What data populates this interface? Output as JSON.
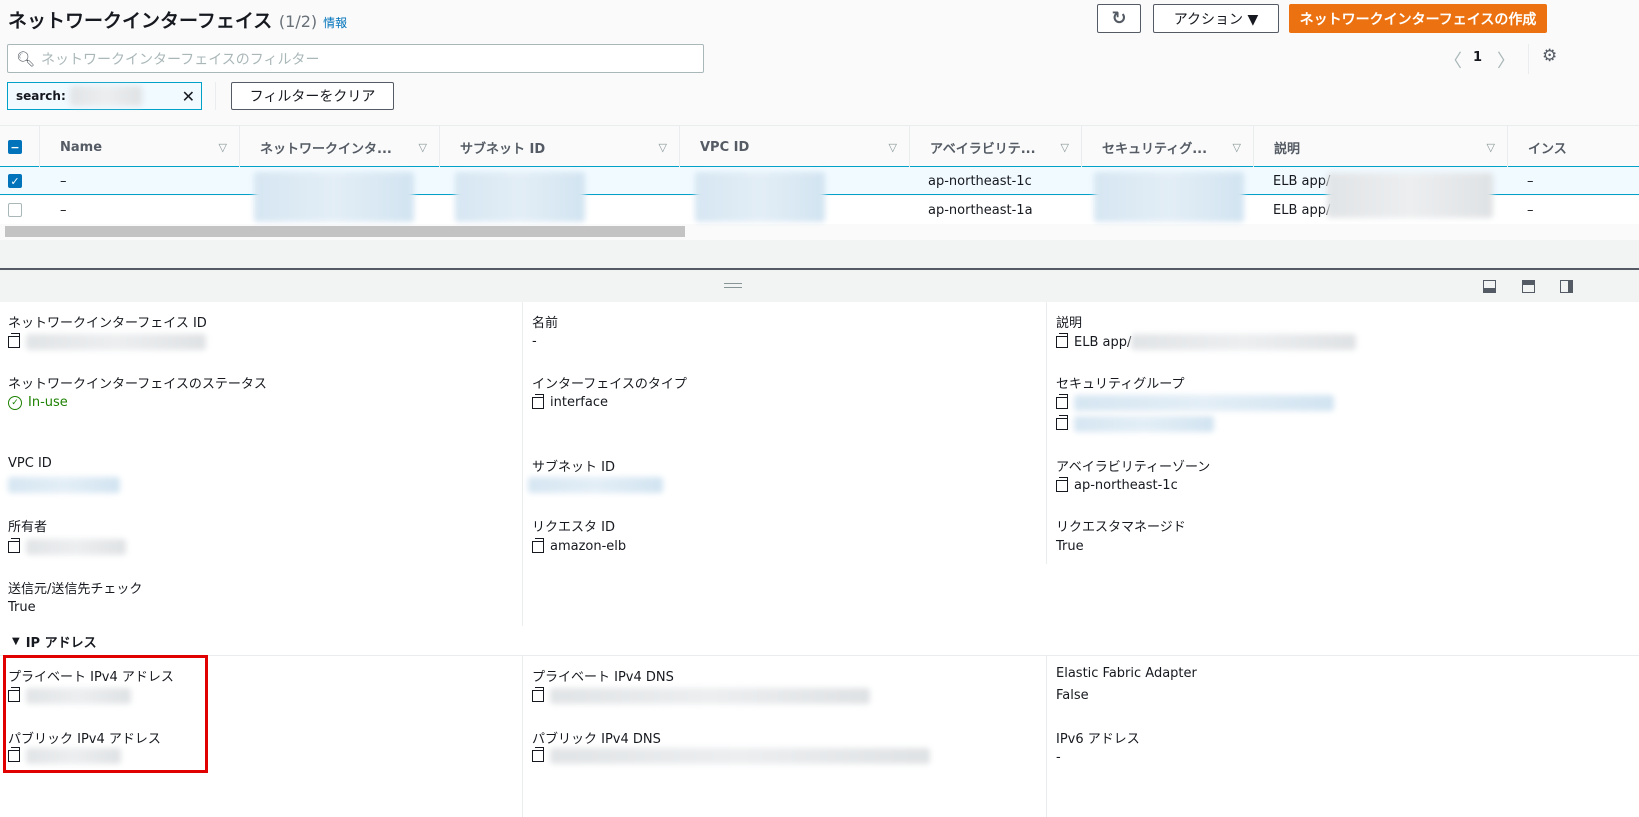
{
  "header": {
    "title": "ネットワークインターフェイス",
    "count": "(1/2)",
    "info_link": "情報",
    "actions_label": "アクション ▼",
    "create_label": "ネットワークインターフェイスの作成"
  },
  "filter": {
    "placeholder": "ネットワークインターフェイスのフィルター",
    "token_label": "search:",
    "clear_label": "フィルターをクリア"
  },
  "pagination": {
    "page": "1"
  },
  "table": {
    "columns": [
      "Name",
      "ネットワークインタ...",
      "サブネット ID",
      "VPC ID",
      "アベイラビリテ...",
      "セキュリティグ...",
      "説明",
      "インス"
    ],
    "rows": [
      {
        "selected": true,
        "name": "–",
        "az": "ap-northeast-1c",
        "desc": "ELB app/",
        "inst": "–"
      },
      {
        "selected": false,
        "name": "–",
        "az": "ap-northeast-1a",
        "desc": "ELB app/",
        "inst": "–"
      }
    ]
  },
  "details": {
    "eni_id_label": "ネットワークインターフェイス ID",
    "name_label": "名前",
    "name_value": "-",
    "desc_label": "説明",
    "desc_value": "ELB app/",
    "status_label": "ネットワークインターフェイスのステータス",
    "status_value": "In-use",
    "type_label": "インターフェイスのタイプ",
    "type_value": "interface",
    "sg_label": "セキュリティグループ",
    "vpc_label": "VPC ID",
    "subnet_label": "サブネット ID",
    "az_label": "アベイラビリティーゾーン",
    "az_value": "ap-northeast-1c",
    "owner_label": "所有者",
    "requester_label": "リクエスタ ID",
    "requester_value": "amazon-elb",
    "managed_label": "リクエスタマネージド",
    "managed_value": "True",
    "srcdst_label": "送信元/送信先チェック",
    "srcdst_value": "True",
    "ip_section": "IP アドレス",
    "priv_ipv4_label": "プライベート IPv4 アドレス",
    "priv_dns_label": "プライベート IPv4 DNS",
    "efa_label": "Elastic Fabric Adapter",
    "efa_value": "False",
    "pub_ipv4_label": "パブリック IPv4 アドレス",
    "pub_dns_label": "パブリック IPv4 DNS",
    "ipv6_label": "IPv6 アドレス",
    "ipv6_value": "-"
  },
  "colors": {
    "accent": "#ec7211",
    "link": "#0073bb",
    "success": "#1d8102",
    "highlight": "#e00000"
  }
}
